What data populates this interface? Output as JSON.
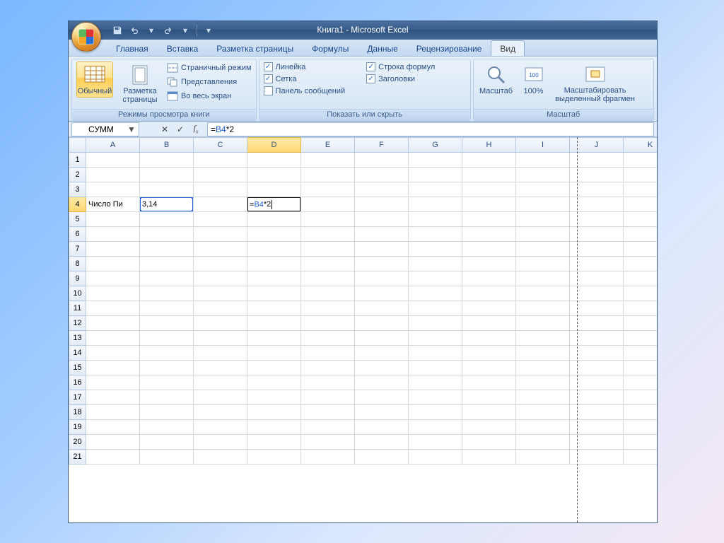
{
  "title": {
    "doc": "Книга1",
    "app": "Microsoft Excel"
  },
  "qat": {
    "save": "save-icon",
    "undo": "undo-icon",
    "redo": "redo-icon"
  },
  "tabs": {
    "items": [
      "Главная",
      "Вставка",
      "Разметка страницы",
      "Формулы",
      "Данные",
      "Рецензирование",
      "Вид"
    ],
    "active": "Вид"
  },
  "ribbon": {
    "views": {
      "normal": "Обычный",
      "page_layout": "Разметка страницы",
      "page_break": "Страничный режим",
      "custom_views": "Представления",
      "full_screen": "Во весь экран",
      "group": "Режимы просмотра книги"
    },
    "show": {
      "ruler": "Линейка",
      "gridlines": "Сетка",
      "message_bar": "Панель сообщений",
      "formula_bar": "Строка формул",
      "headings": "Заголовки",
      "group": "Показать или скрыть",
      "ruler_checked": true,
      "gridlines_checked": true,
      "message_bar_checked": false,
      "formula_bar_checked": true,
      "headings_checked": true
    },
    "zoom": {
      "zoom": "Масштаб",
      "hundred": "100%",
      "to_selection_l1": "Масштабировать",
      "to_selection_l2": "выделенный фрагмен",
      "group": "Масштаб"
    }
  },
  "formula_bar": {
    "namebox": "СУММ",
    "formula": "=B4*2",
    "formula_prefix": "=",
    "formula_ref": "B4",
    "formula_suffix": "*2"
  },
  "columns": [
    "A",
    "B",
    "C",
    "D",
    "E",
    "F",
    "G",
    "H",
    "I",
    "J",
    "K"
  ],
  "rows": 21,
  "cells": {
    "A4": "Число Пи",
    "B4": "3,14",
    "D4_prefix": "=",
    "D4_ref": "B4",
    "D4_suffix": "*2"
  },
  "selection": {
    "ref_cell": "B4",
    "edit_cell": "D4",
    "active_row": 4,
    "active_col": "D"
  }
}
